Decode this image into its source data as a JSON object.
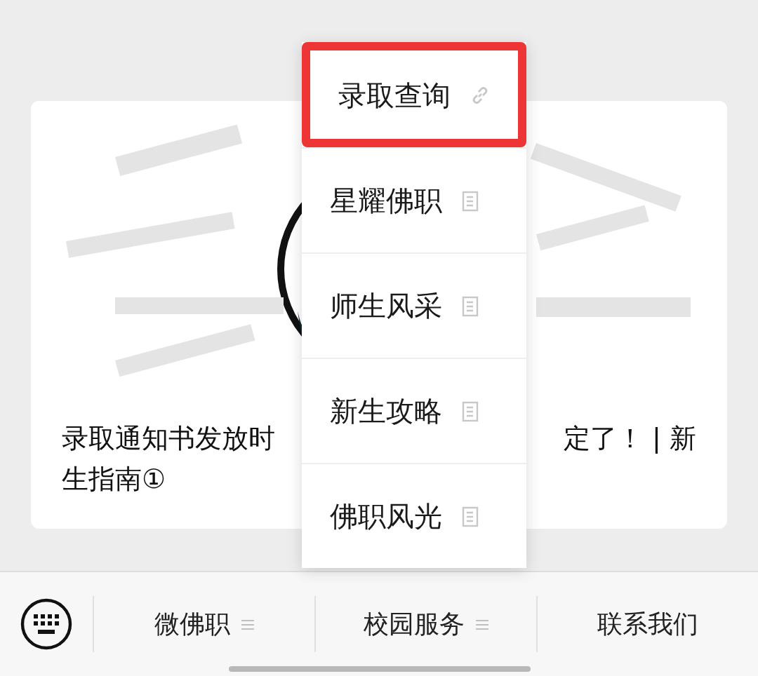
{
  "article": {
    "title_parts": [
      "录取通知书发放时",
      "定了！ | 新",
      "生指南①"
    ]
  },
  "popup_menu": {
    "items": [
      {
        "label": "录取查询",
        "kind": "link",
        "highlighted": true
      },
      {
        "label": "星耀佛职",
        "kind": "article",
        "highlighted": false
      },
      {
        "label": "师生风采",
        "kind": "article",
        "highlighted": false
      },
      {
        "label": "新生攻略",
        "kind": "article",
        "highlighted": false
      },
      {
        "label": "佛职风光",
        "kind": "article",
        "highlighted": false
      }
    ]
  },
  "bottom_menu": {
    "items": [
      {
        "label": "微佛职",
        "has_submenu": true
      },
      {
        "label": "校园服务",
        "has_submenu": true
      },
      {
        "label": "联系我们",
        "has_submenu": false
      }
    ]
  }
}
